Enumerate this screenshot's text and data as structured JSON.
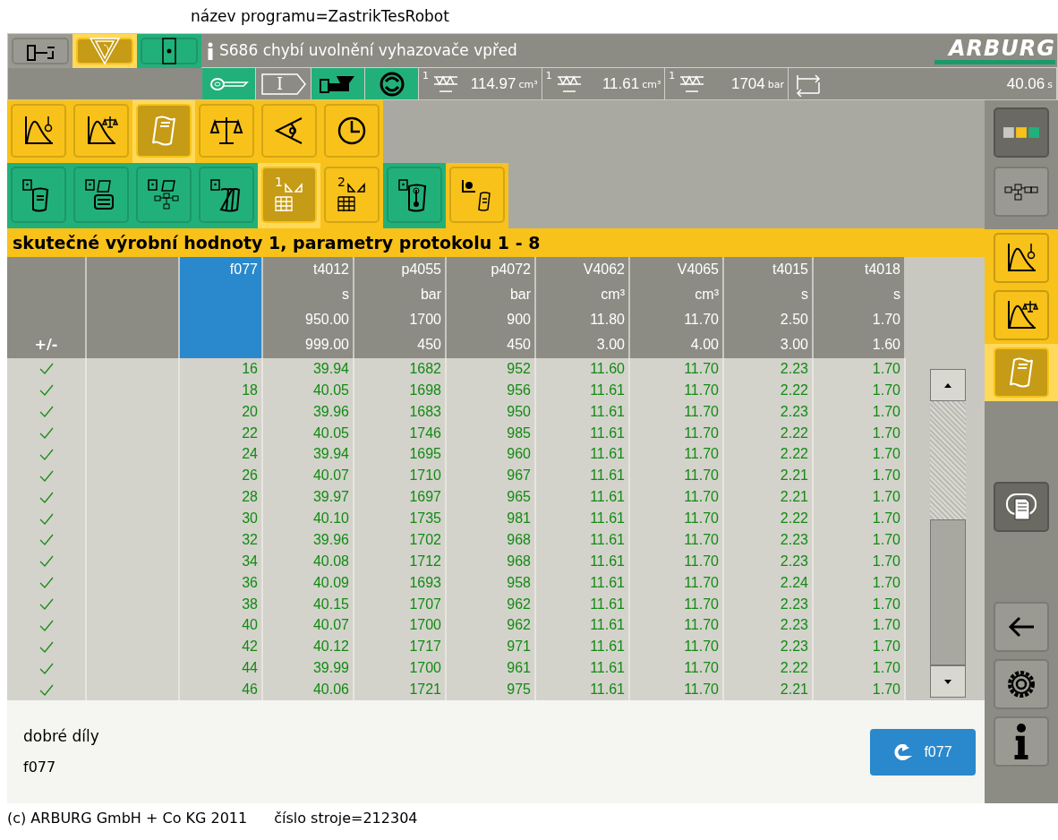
{
  "program_name": "název programu=ZastrikTesRobot",
  "mode_buttons": [
    {
      "color": "#9a9a92",
      "selected": false
    },
    {
      "color": "#f8c21a",
      "selected": true
    },
    {
      "color": "#22b07a",
      "selected": false
    }
  ],
  "message": "S686 chybí uvolnění vyhazovače vpřed",
  "logo": "ARBURG",
  "mode_label": "I",
  "readings": [
    {
      "index": "1",
      "value": "114.97",
      "unit": "cm³"
    },
    {
      "index": "1",
      "value": "11.61",
      "unit": "cm³"
    },
    {
      "index": "1",
      "value": "1704",
      "unit": "bar"
    },
    {
      "value": "40.06",
      "unit": "s"
    }
  ],
  "toolbar_1": [
    {
      "color": "#f8c21a",
      "selected": false
    },
    {
      "color": "#f8c21a",
      "selected": false
    },
    {
      "color": "#f8c21a",
      "selected": true
    },
    {
      "color": "#f8c21a",
      "selected": false
    },
    {
      "color": "#f8c21a",
      "selected": false
    },
    {
      "color": "#f8c21a",
      "selected": false
    }
  ],
  "toolbar_2": [
    {
      "color": "#22b07a",
      "selected": false
    },
    {
      "color": "#22b07a",
      "selected": false
    },
    {
      "color": "#22b07a",
      "selected": false
    },
    {
      "color": "#22b07a",
      "selected": false
    },
    {
      "color": "#f8c21a",
      "selected": true,
      "number": "1"
    },
    {
      "color": "#f8c21a",
      "selected": false,
      "number": "2"
    },
    {
      "color": "#22b07a",
      "selected": false
    },
    {
      "color": "#f8c21a",
      "selected": false
    }
  ],
  "section_title": "skutečné výrobní hodnoty 1, parametry protokolu 1 - 8",
  "table": {
    "status_column": {
      "label": "+/-"
    },
    "columns": [
      {
        "name": "f077",
        "selected": true
      },
      {
        "name": "t4012",
        "unit": "s",
        "upper": "950.00",
        "lower": "999.00",
        "selected": false
      },
      {
        "name": "p4055",
        "unit": "bar",
        "upper": "1700",
        "lower": "450",
        "selected": false
      },
      {
        "name": "p4072",
        "unit": "bar",
        "upper": "900",
        "lower": "450",
        "selected": false
      },
      {
        "name": "V4062",
        "unit": "cm³",
        "upper": "11.80",
        "lower": "3.00",
        "selected": false
      },
      {
        "name": "V4065",
        "unit": "cm³",
        "upper": "11.70",
        "lower": "4.00",
        "selected": false
      },
      {
        "name": "t4015",
        "unit": "s",
        "upper": "2.50",
        "lower": "3.00",
        "selected": false
      },
      {
        "name": "t4018",
        "unit": "s",
        "upper": "1.70",
        "lower": "1.60",
        "selected": false
      }
    ],
    "rows": [
      {
        "ok": true,
        "cells": [
          "16",
          "39.94",
          "1682",
          "952",
          "11.60",
          "11.70",
          "2.23",
          "1.70"
        ]
      },
      {
        "ok": true,
        "cells": [
          "18",
          "40.05",
          "1698",
          "956",
          "11.61",
          "11.70",
          "2.22",
          "1.70"
        ]
      },
      {
        "ok": true,
        "cells": [
          "20",
          "39.96",
          "1683",
          "950",
          "11.61",
          "11.70",
          "2.23",
          "1.70"
        ]
      },
      {
        "ok": true,
        "cells": [
          "22",
          "40.05",
          "1746",
          "985",
          "11.61",
          "11.70",
          "2.22",
          "1.70"
        ]
      },
      {
        "ok": true,
        "cells": [
          "24",
          "39.94",
          "1695",
          "960",
          "11.61",
          "11.70",
          "2.22",
          "1.70"
        ]
      },
      {
        "ok": true,
        "cells": [
          "26",
          "40.07",
          "1710",
          "967",
          "11.61",
          "11.70",
          "2.21",
          "1.70"
        ]
      },
      {
        "ok": true,
        "cells": [
          "28",
          "39.97",
          "1697",
          "965",
          "11.61",
          "11.70",
          "2.21",
          "1.70"
        ]
      },
      {
        "ok": true,
        "cells": [
          "30",
          "40.10",
          "1735",
          "981",
          "11.61",
          "11.70",
          "2.22",
          "1.70"
        ]
      },
      {
        "ok": true,
        "cells": [
          "32",
          "39.96",
          "1702",
          "968",
          "11.61",
          "11.70",
          "2.23",
          "1.70"
        ]
      },
      {
        "ok": true,
        "cells": [
          "34",
          "40.08",
          "1712",
          "968",
          "11.61",
          "11.70",
          "2.23",
          "1.70"
        ]
      },
      {
        "ok": true,
        "cells": [
          "36",
          "40.09",
          "1693",
          "958",
          "11.61",
          "11.70",
          "2.24",
          "1.70"
        ]
      },
      {
        "ok": true,
        "cells": [
          "38",
          "40.15",
          "1707",
          "962",
          "11.61",
          "11.70",
          "2.23",
          "1.70"
        ]
      },
      {
        "ok": true,
        "cells": [
          "40",
          "40.07",
          "1700",
          "962",
          "11.61",
          "11.70",
          "2.23",
          "1.70"
        ]
      },
      {
        "ok": true,
        "cells": [
          "42",
          "40.12",
          "1717",
          "971",
          "11.61",
          "11.70",
          "2.23",
          "1.70"
        ]
      },
      {
        "ok": true,
        "cells": [
          "44",
          "39.99",
          "1700",
          "961",
          "11.61",
          "11.70",
          "2.22",
          "1.70"
        ]
      },
      {
        "ok": true,
        "cells": [
          "46",
          "40.06",
          "1721",
          "975",
          "11.61",
          "11.70",
          "2.21",
          "1.70"
        ]
      }
    ]
  },
  "sidebar": [
    {
      "color": "#6a6a63",
      "selected": false
    },
    {
      "color": "#9a9a92",
      "selected": false
    },
    {
      "color": "#f8c21a",
      "selected": false
    },
    {
      "color": "#f8c21a",
      "selected": false
    },
    {
      "color": "#f8c21a",
      "selected": true
    },
    {
      "color": "#6a6a63",
      "selected": false
    },
    {
      "color": "#9a9a92",
      "selected": false
    },
    {
      "color": "#9a9a92",
      "selected": false
    },
    {
      "color": "#9a9a92",
      "selected": false
    }
  ],
  "info_panel": {
    "label": "dobré díly",
    "value": "f077",
    "button": "f077"
  },
  "footer": {
    "copyright": "(c) ARBURG GmbH + Co KG 2011",
    "machine": "číslo stroje=212304"
  }
}
